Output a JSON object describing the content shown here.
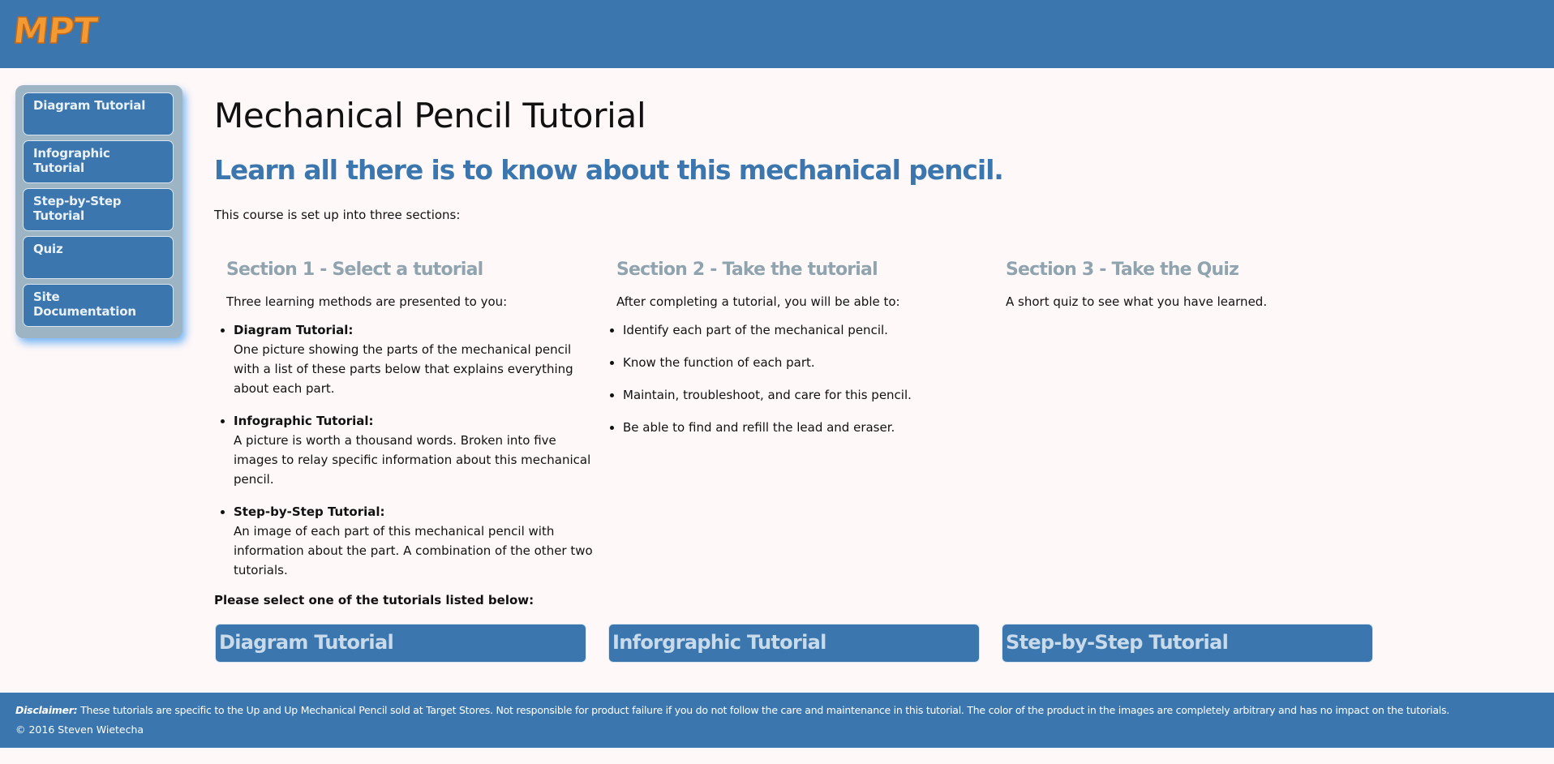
{
  "header": {
    "logo_text": "MPT",
    "logo_fill": "#f39a32",
    "logo_stroke": "#c2691a"
  },
  "sidebar": {
    "items": [
      {
        "label": "Diagram Tutorial"
      },
      {
        "label": "Infographic Tutorial"
      },
      {
        "label": "Step-by-Step Tutorial"
      },
      {
        "label": "Quiz"
      },
      {
        "label": "Site Documentation"
      }
    ]
  },
  "main": {
    "title": "Mechanical Pencil Tutorial",
    "subtitle": "Learn all there is to know about this mechanical pencil.",
    "intro": "This course is set up into three sections:",
    "sections": [
      {
        "title": "Section 1 - Select a tutorial",
        "subtitle": "Three learning methods are presented to you:",
        "items": [
          {
            "name": "Diagram Tutorial:",
            "text": "One picture showing the parts of the mechanical pencil with a list of these parts below that explains everything about each part."
          },
          {
            "name": "Infographic Tutorial:",
            "text": "A picture is worth a thousand words. Broken into five images to relay specific information about this mechanical pencil."
          },
          {
            "name": "Step-by-Step Tutorial:",
            "text": "An image of each part of this mechanical pencil with information about the part. A combination of the other two tutorials."
          }
        ]
      },
      {
        "title": "Section 2 - Take the tutorial",
        "subtitle": "After completing a tutorial, you will be able to:",
        "items": [
          "Identify each part of the mechanical pencil.",
          "Know the function of each part.",
          "Maintain, troubleshoot, and care for this pencil.",
          "Be able to find and refill the lead and eraser."
        ]
      },
      {
        "title": "Section 3 - Take the Quiz",
        "subtitle": "A short quiz to see what you have learned."
      }
    ],
    "select_prompt": "Please select one of the tutorials listed below:",
    "tutorial_buttons": [
      {
        "label": "Diagram Tutorial"
      },
      {
        "label": "Inforgraphic Tutorial"
      },
      {
        "label": "Step-by-Step Tutorial"
      }
    ]
  },
  "footer": {
    "disclaimer_label": "Disclaimer:",
    "disclaimer_text": " These tutorials are specific to the Up and Up Mechanical Pencil sold at Target Stores. Not responsible for product failure if you do not follow the care and maintenance in this tutorial. The color of the product in the images are completely arbitrary and has no impact on the tutorials.",
    "copyright": "© 2016 Steven Wietecha"
  },
  "colors": {
    "brand_blue": "#3b77ae",
    "section_title": "#8fa4ae",
    "page_background": "#fff8f8"
  }
}
